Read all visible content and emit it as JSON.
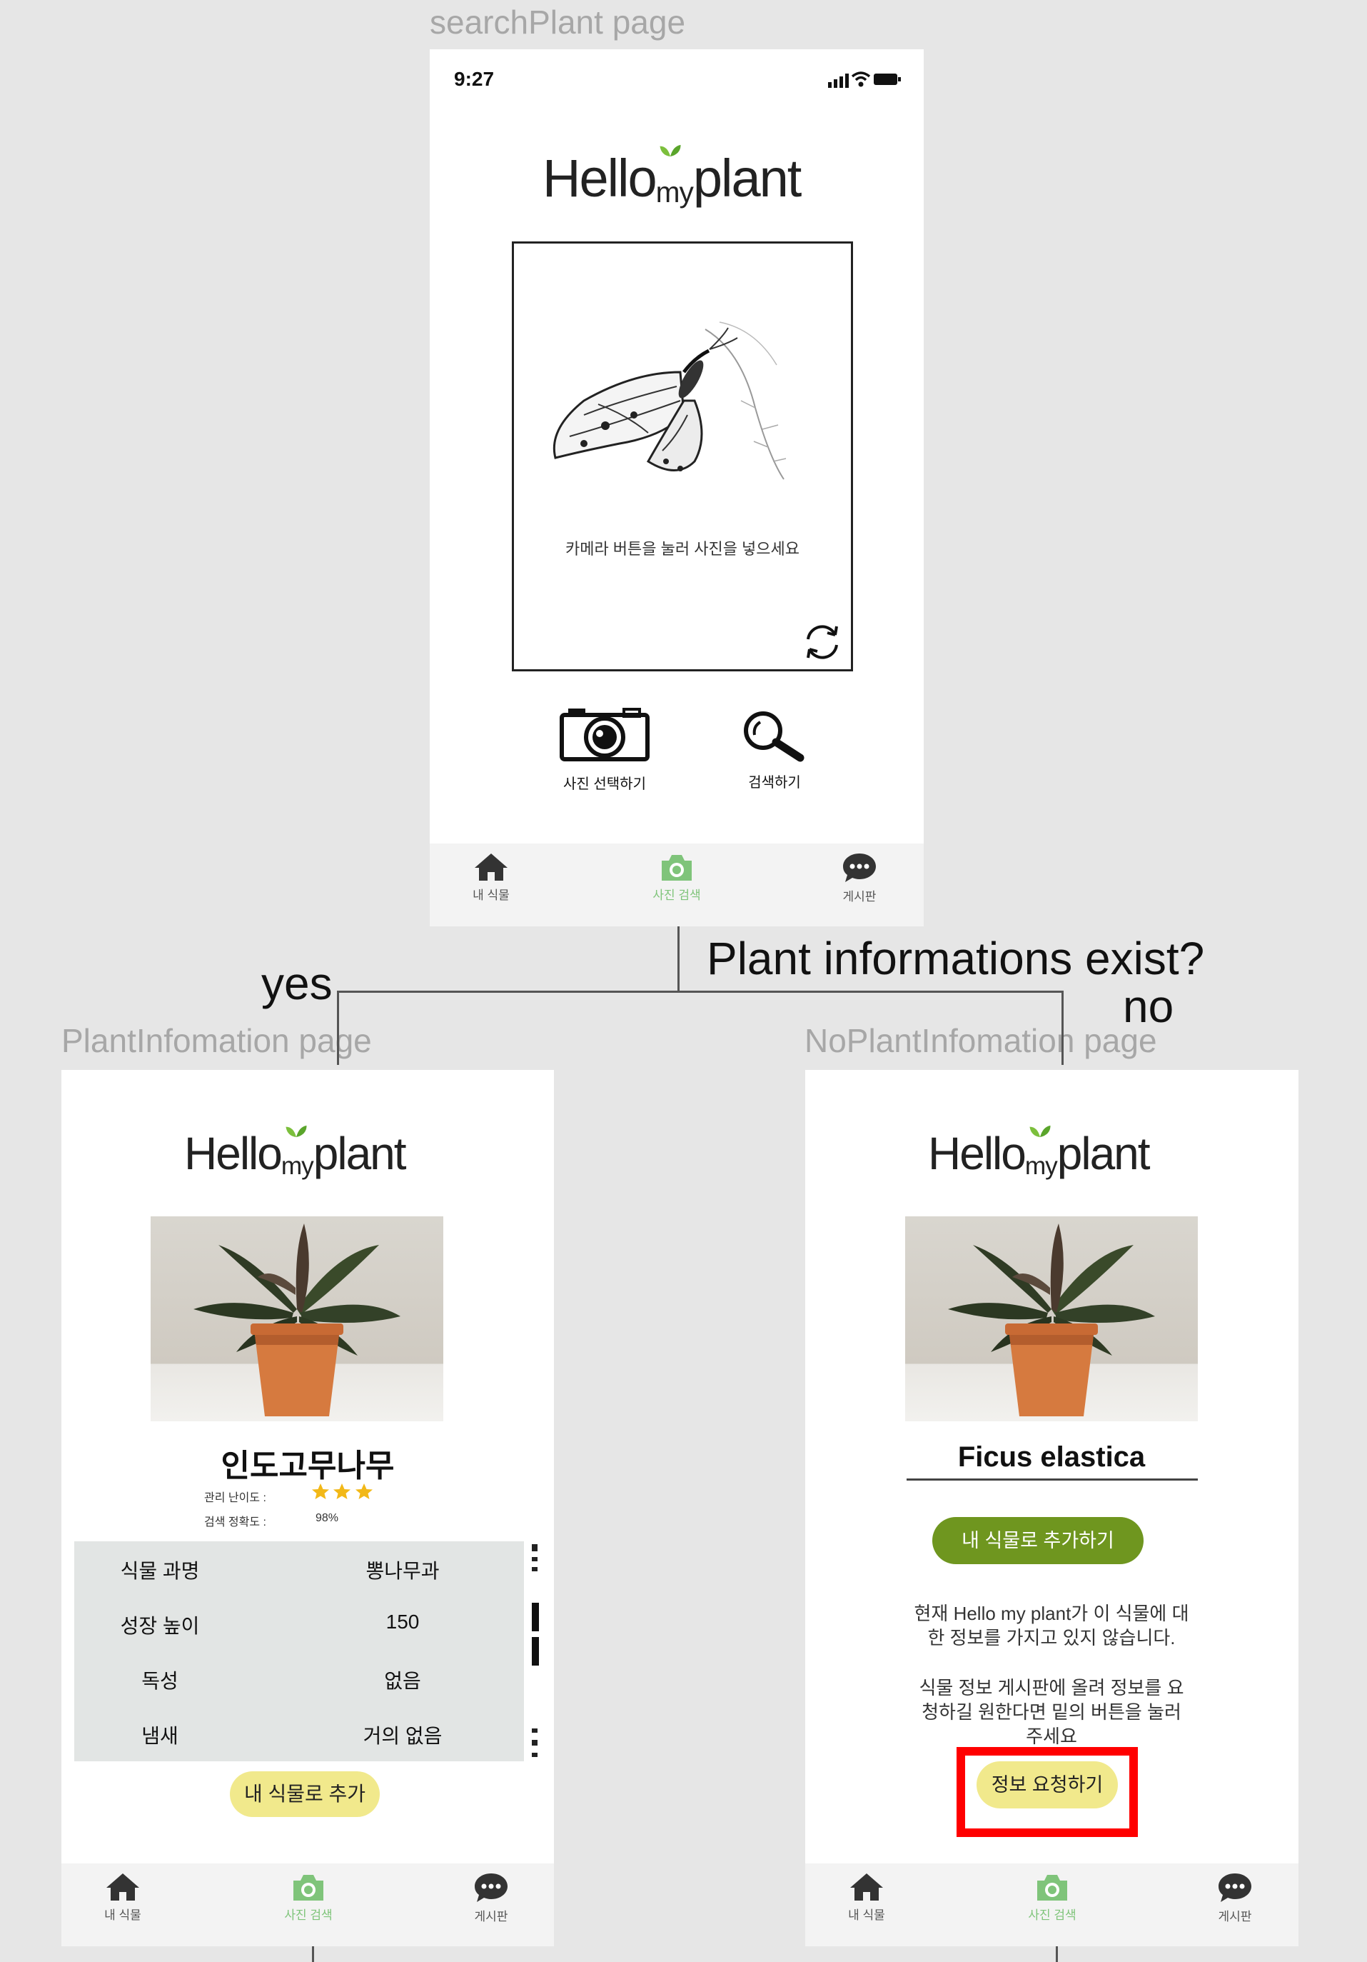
{
  "labels": {
    "search_page": "searchPlant page",
    "info_page": "PlantInfomation page",
    "noinfo_page": "NoPlantInfomation page",
    "question": "Plant informations exist?",
    "yes": "yes",
    "no": "no"
  },
  "search": {
    "time": "9:27",
    "logo_hello": "Hello",
    "logo_my": "my",
    "logo_plant": "plant",
    "camera_hint": "카메라 버튼을 눌러 사진을 넣으세요",
    "select_photo": "사진 선택하기",
    "search_label": "검색하기"
  },
  "tabs": {
    "home": "내 식물",
    "photo": "사진 검색",
    "board": "게시판"
  },
  "info": {
    "logo_hello": "Hello",
    "logo_my": "my",
    "logo_plant": "plant",
    "plant_name": "인도고무나무",
    "difficulty_label": "관리 난이도 :",
    "difficulty_stars": 3,
    "accuracy_label": "검색 정확도 :",
    "accuracy_value": "98%",
    "rows": [
      {
        "key": "식물 과명",
        "value": "뽕나무과"
      },
      {
        "key": "성장 높이",
        "value": "150"
      },
      {
        "key": "독성",
        "value": "없음"
      },
      {
        "key": "냄새",
        "value": "거의 없음"
      }
    ],
    "add_button": "내 식물로 추가"
  },
  "noinfo": {
    "logo_hello": "Hello",
    "logo_my": "my",
    "logo_plant": "plant",
    "plant_name": "Ficus elastica",
    "add_button": "내 식물로 추가하기",
    "message1_line1": "현재 Hello my plant가 이 식물에 대",
    "message1_line2": "한 정보를 가지고 있지 않습니다.",
    "message2_line1": "식물 정보 게시판에 올려 정보를 요",
    "message2_line2": "청하길 원한다면 밑의 버튼을 눌러",
    "message2_line3": "주세요",
    "request_button": "정보 요청하기"
  },
  "colors": {
    "background": "#e6e6e6",
    "active_tab": "#7fc47a",
    "green_button": "#6f961f",
    "yellow_button": "#f1e98c",
    "highlight": "#ff0000",
    "star": "#f2b817",
    "leaf": "#7cbf3c"
  },
  "icons": [
    "camera-icon",
    "search-icon",
    "refresh-icon",
    "home-icon",
    "tab-camera-icon",
    "chat-icon",
    "butterfly-illustration",
    "potted-plant-photo",
    "signal-icon",
    "wifi-icon",
    "battery-icon",
    "star-icon"
  ]
}
